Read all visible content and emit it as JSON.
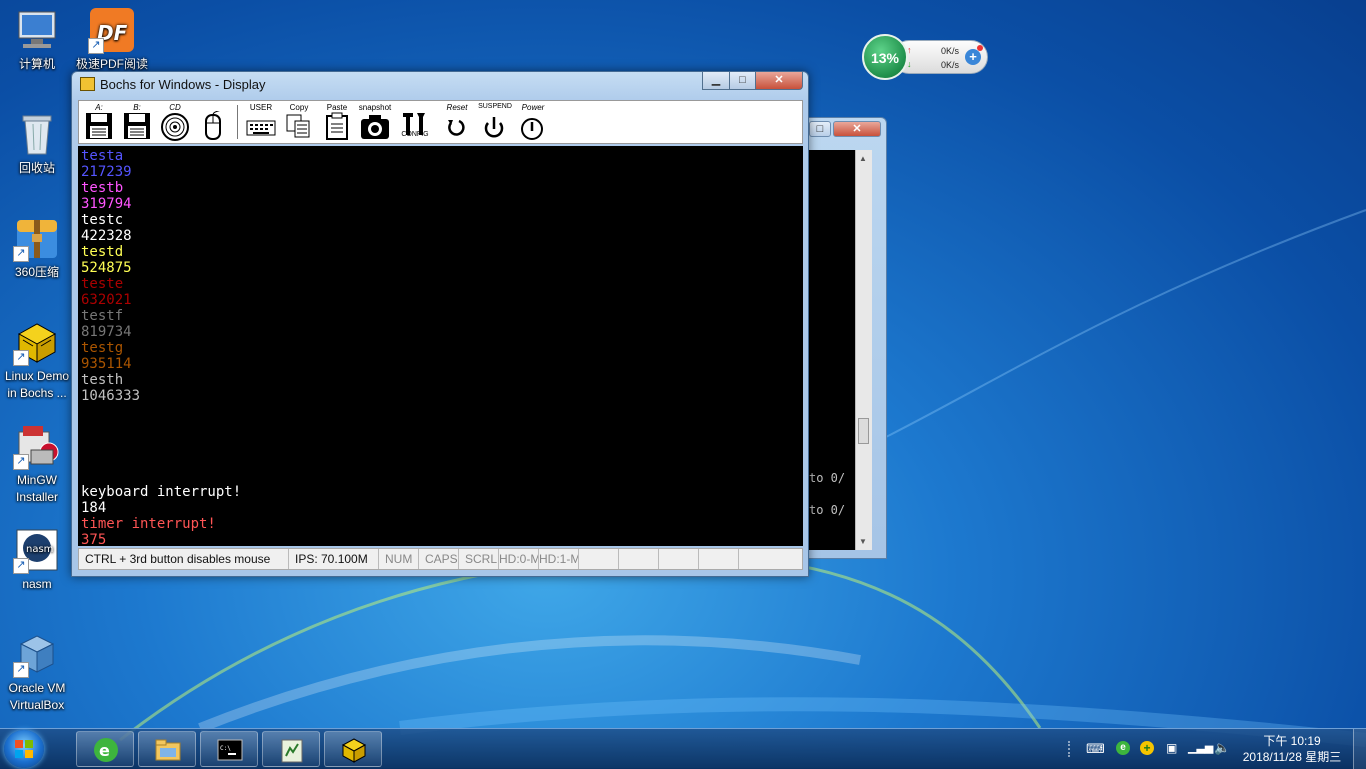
{
  "desktop": {
    "icons": [
      {
        "label": "计算机",
        "icon": "computer-icon"
      },
      {
        "label": "极速PDF阅读",
        "icon": "pdf-reader-icon"
      },
      {
        "label": "回收站",
        "icon": "recycle-bin-icon"
      },
      {
        "label": "360压缩",
        "icon": "zip-archive-icon"
      },
      {
        "label": "Linux Demo in Bochs ...",
        "icon": "bochs-icon"
      },
      {
        "label": "MinGW Installer",
        "icon": "installer-icon"
      },
      {
        "label": "nasm",
        "icon": "nasm-icon"
      },
      {
        "label": "Oracle VM VirtualBox",
        "icon": "virtualbox-icon"
      }
    ]
  },
  "gadget": {
    "cpu_percent": "13%",
    "upload": "0K/s",
    "download": "0K/s"
  },
  "back_window": {
    "lines": [
      "",
      "to 0/",
      "to 0/"
    ]
  },
  "window": {
    "title": "Bochs for Windows - Display",
    "toolbar": {
      "floppy_a": "A:",
      "floppy_b": "B:",
      "cdrom": "CD",
      "user": "USER",
      "copy": "Copy",
      "paste": "Paste",
      "snapshot": "snapshot",
      "config": "CONFIG",
      "reset": "Reset",
      "suspend": "SUSPEND",
      "power": "Power"
    },
    "screen_lines": [
      {
        "text": "testa",
        "color": "#5555ff"
      },
      {
        "text": "217239",
        "color": "#5555ff"
      },
      {
        "text": "testb",
        "color": "#ff55ff"
      },
      {
        "text": "319794",
        "color": "#ff55ff"
      },
      {
        "text": "testc",
        "color": "#ffffff"
      },
      {
        "text": "422328",
        "color": "#ffffff"
      },
      {
        "text": "testd",
        "color": "#ffff55"
      },
      {
        "text": "524875",
        "color": "#ffff55"
      },
      {
        "text": "teste",
        "color": "#aa0000"
      },
      {
        "text": "632021",
        "color": "#aa0000"
      },
      {
        "text": "testf",
        "color": "#777777"
      },
      {
        "text": "819734",
        "color": "#777777"
      },
      {
        "text": "testg",
        "color": "#aa5500"
      },
      {
        "text": "935114",
        "color": "#aa5500"
      },
      {
        "text": "testh",
        "color": "#c0c0c0"
      },
      {
        "text": "1046333",
        "color": "#c0c0c0"
      },
      {
        "text": "",
        "color": "#c0c0c0"
      },
      {
        "text": "",
        "color": "#c0c0c0"
      },
      {
        "text": "",
        "color": "#c0c0c0"
      },
      {
        "text": "",
        "color": "#c0c0c0"
      },
      {
        "text": "",
        "color": "#c0c0c0"
      },
      {
        "text": "keyboard interrupt!",
        "color": "#ffffff"
      },
      {
        "text": "184",
        "color": "#ffffff"
      },
      {
        "text": "timer interrupt!",
        "color": "#ff5555"
      },
      {
        "text": "375",
        "color": "#ff5555"
      }
    ],
    "status": {
      "mouse_hint": "CTRL + 3rd button disables mouse",
      "ips": "IPS: 70.100M",
      "num": "NUM",
      "caps": "CAPS",
      "scrl": "SCRL",
      "hd0": "HD:0-M",
      "hd1": "HD:1-M"
    }
  },
  "taskbar": {
    "clock_time": "下午 10:19",
    "clock_date": "2018/11/28 星期三"
  }
}
